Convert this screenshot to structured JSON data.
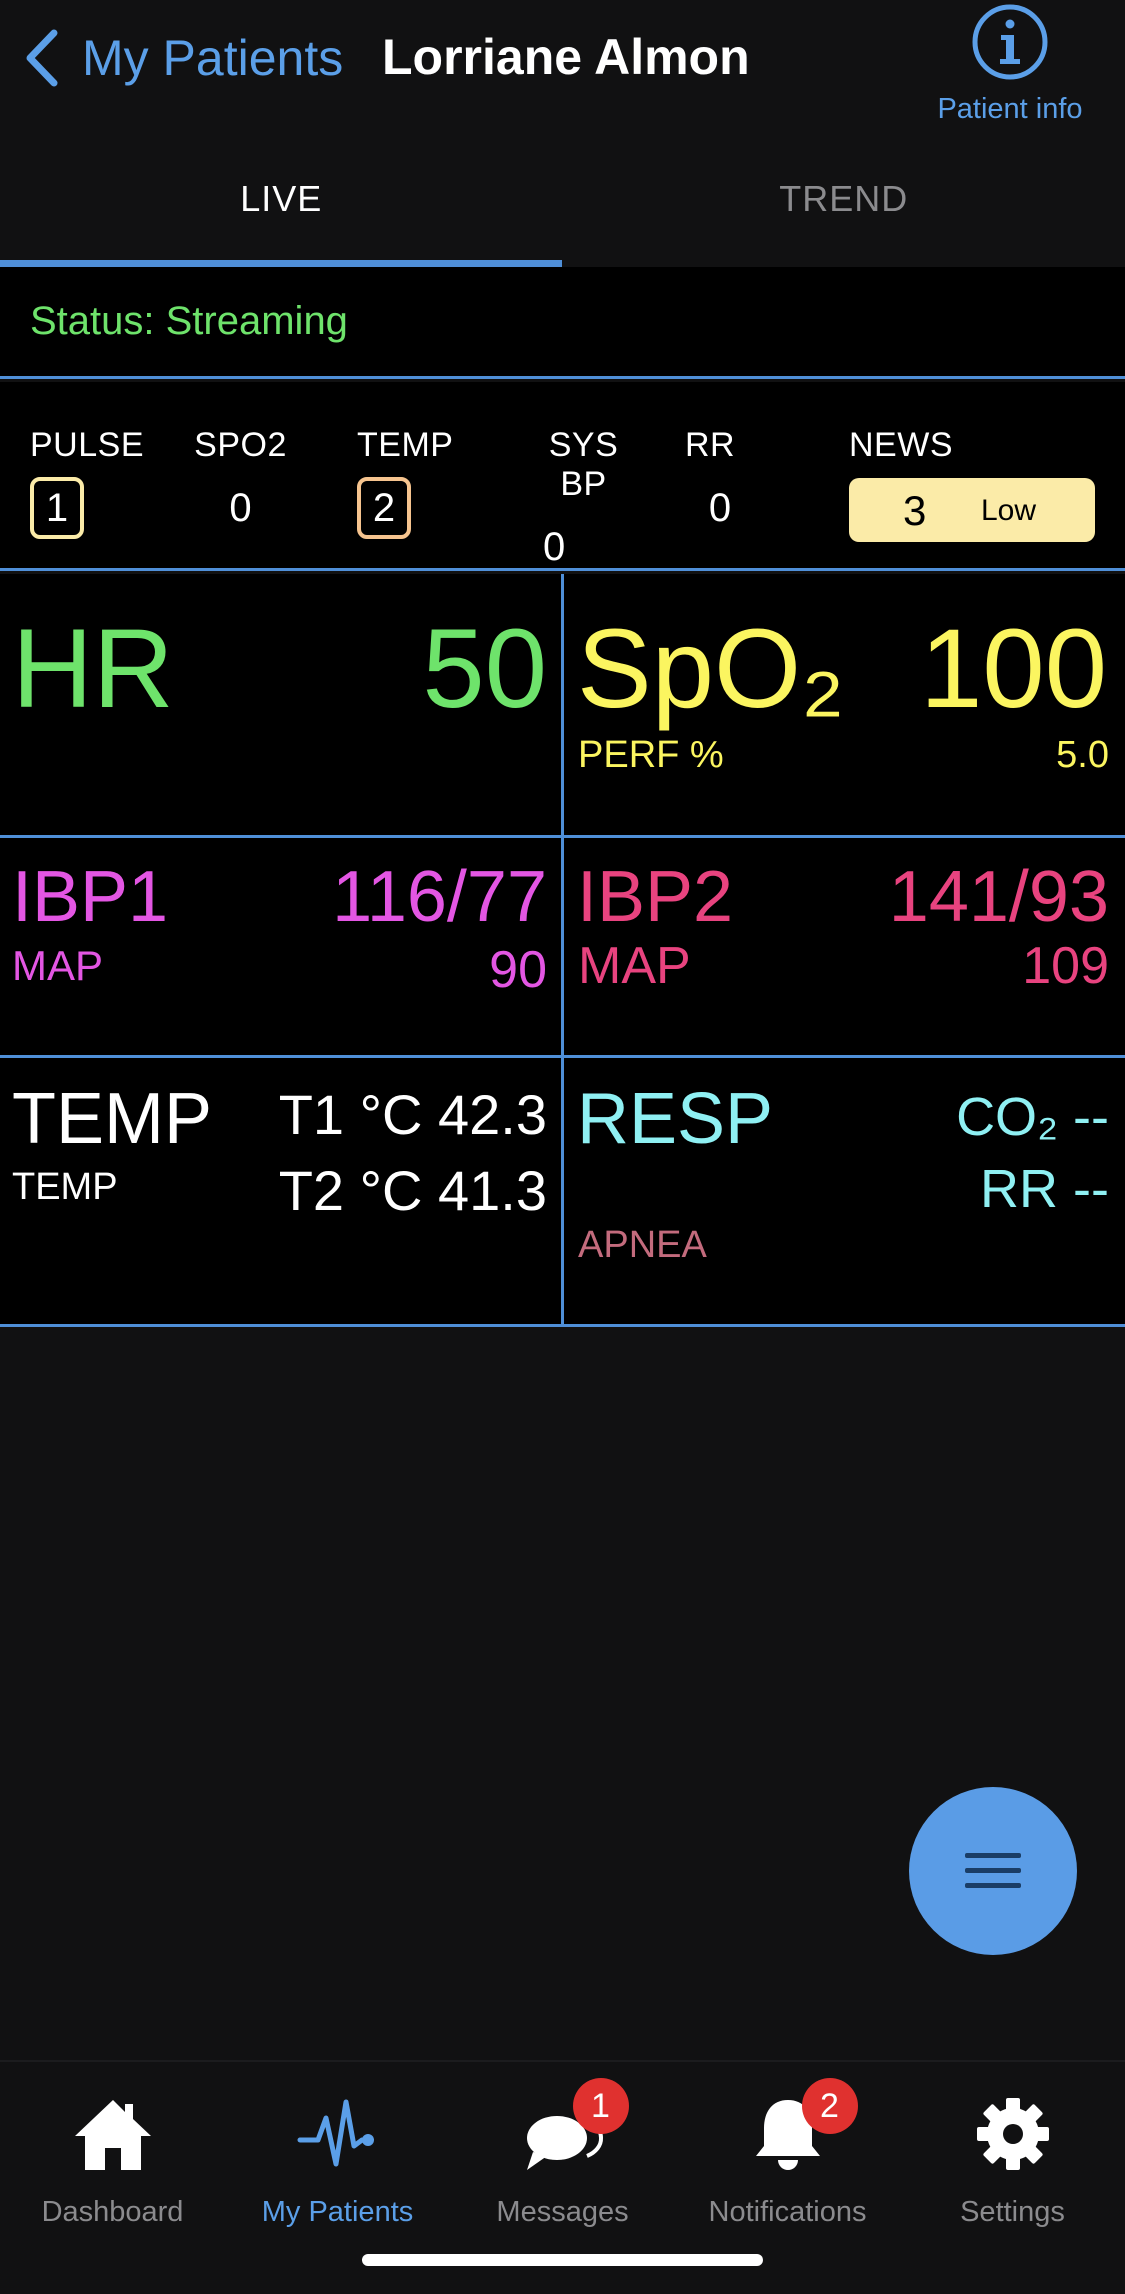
{
  "header": {
    "back_label": "My Patients",
    "patient_name": "Lorriane Almon",
    "info_label": "Patient info"
  },
  "tabs": [
    {
      "label": "LIVE",
      "active": true
    },
    {
      "label": "TREND",
      "active": false
    }
  ],
  "status": {
    "text": "Status: Streaming",
    "color": "#6ee36b"
  },
  "scores": {
    "pulse": {
      "label": "PULSE",
      "value": "1",
      "boxed": true,
      "box_color": "#fbeba8"
    },
    "spo2": {
      "label": "SPO2",
      "value": "0"
    },
    "temp": {
      "label": "TEMP",
      "value": "2",
      "boxed": true,
      "box_color": "#f6c48f"
    },
    "sysbp": {
      "label": "SYS BP",
      "value": "0"
    },
    "rr": {
      "label": "RR",
      "value": "0"
    },
    "news": {
      "label": "NEWS",
      "value": "3",
      "level": "Low",
      "color": "#fbeba8"
    }
  },
  "vitals": {
    "hr": {
      "label": "HR",
      "value": "50",
      "color": "#6ee36b"
    },
    "spo2": {
      "label": "SpO₂",
      "value": "100",
      "sub_label": "PERF %",
      "sub_value": "5.0",
      "color": "#fbf560"
    },
    "ibp1": {
      "label": "IBP1",
      "value": "116/77",
      "sub_label": "MAP",
      "sub_value": "90",
      "color": "#e356e3"
    },
    "ibp2": {
      "label": "IBP2",
      "value": "141/93",
      "sub_label": "MAP",
      "sub_value": "109",
      "color": "#e8437f"
    },
    "temp": {
      "label": "TEMP",
      "sub_label": "TEMP",
      "t1": "T1 °C 42.3",
      "t2": "T2 °C 41.3",
      "color": "#ffffff"
    },
    "resp": {
      "label": "RESP",
      "co2": "CO₂ --",
      "rr": "RR --",
      "apnea": "APNEA",
      "color": "#8ff0f3",
      "apnea_color": "#c36b7d"
    }
  },
  "bottom_nav": [
    {
      "label": "Dashboard",
      "icon": "home-icon",
      "active": false
    },
    {
      "label": "My Patients",
      "icon": "heartbeat-icon",
      "active": true
    },
    {
      "label": "Messages",
      "icon": "messages-icon",
      "active": false,
      "badge": "1"
    },
    {
      "label": "Notifications",
      "icon": "bell-icon",
      "active": false,
      "badge": "2"
    },
    {
      "label": "Settings",
      "icon": "gear-icon",
      "active": false
    }
  ],
  "colors": {
    "accent": "#5b9fe8",
    "divider": "#4f8fd8",
    "badge": "#e0312f"
  }
}
